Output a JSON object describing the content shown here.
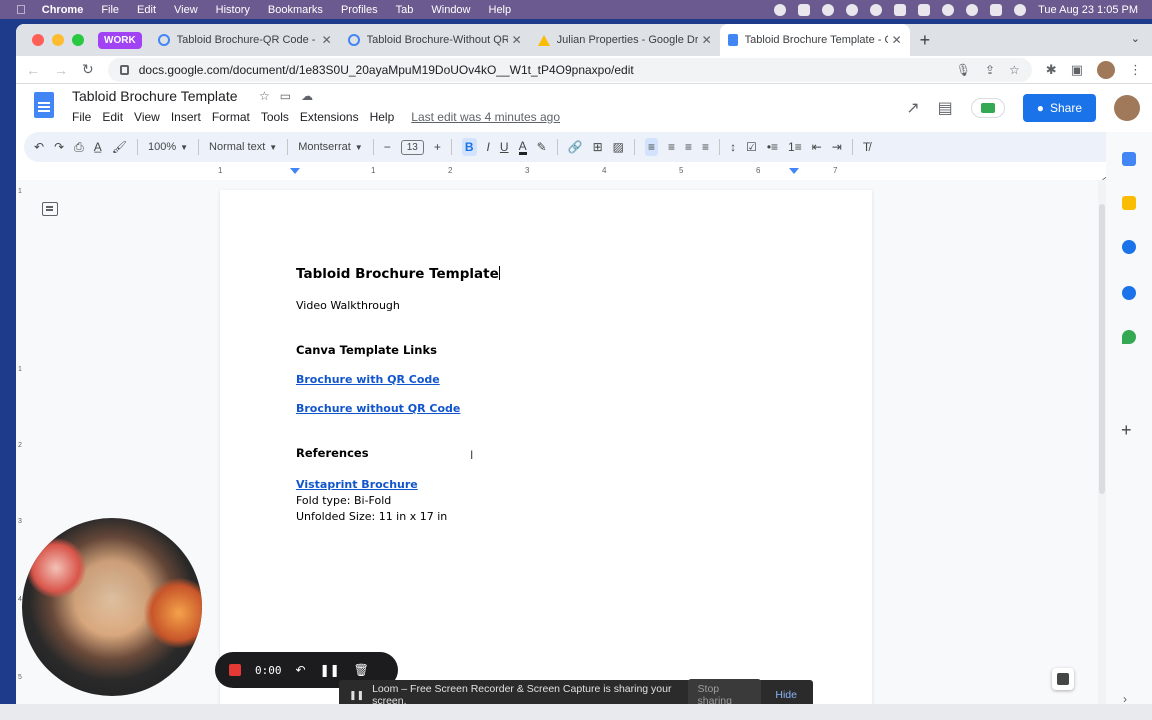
{
  "menubar": {
    "app": "Chrome",
    "items": [
      "File",
      "Edit",
      "View",
      "History",
      "Bookmarks",
      "Profiles",
      "Tab",
      "Window",
      "Help"
    ],
    "clock": "Tue Aug 23  1:05 PM"
  },
  "browser": {
    "profile_badge": "WORK",
    "tabs": [
      {
        "title": "Tabloid Brochure-QR Code - 1",
        "icon": "canva-icon"
      },
      {
        "title": "Tabloid Brochure-Without QR C",
        "icon": "canva-icon"
      },
      {
        "title": "Julian Properties - Google Driv",
        "icon": "drive-icon"
      },
      {
        "title": "Tabloid Brochure Template - G",
        "icon": "docs-icon"
      }
    ],
    "url": "docs.google.com/document/d/1e83S0U_20ayaMpuM19DoUOv4kO__W1t_tP4O9pnaxpo/edit"
  },
  "docs": {
    "title": "Tabloid Brochure Template",
    "menus": [
      "File",
      "Edit",
      "View",
      "Insert",
      "Format",
      "Tools",
      "Extensions",
      "Help"
    ],
    "last_edit": "Last edit was 4 minutes ago",
    "share_label": "Share",
    "toolbar": {
      "zoom": "100%",
      "style": "Normal text",
      "font": "Montserrat",
      "font_size": "13"
    },
    "ruler": [
      "1",
      "1",
      "2",
      "3",
      "4",
      "5",
      "6",
      "7"
    ],
    "vruler": [
      "1",
      "1",
      "2",
      "3",
      "4",
      "5"
    ],
    "content": {
      "heading": "Tabloid Brochure Template",
      "line1": "Video Walkthrough",
      "section1": "Canva Template Links",
      "link1": "Brochure with QR Code",
      "link2": "Brochure without QR Code",
      "section2": "References",
      "link3": "Vistaprint Brochure",
      "fold": "Fold type: Bi-Fold",
      "size": "Unfolded Size: 11 in x 17 in"
    }
  },
  "loom": {
    "timer": "0:00",
    "banner_text": "Loom – Free Screen Recorder & Screen Capture is sharing your screen.",
    "stop_label": "Stop sharing",
    "hide_label": "Hide"
  },
  "colors": {
    "accent": "#1a73e8",
    "link": "#1155cc",
    "menubar": "#6b5a8f",
    "profile_badge": "#a142f4",
    "loom_stop": "#e53935"
  }
}
